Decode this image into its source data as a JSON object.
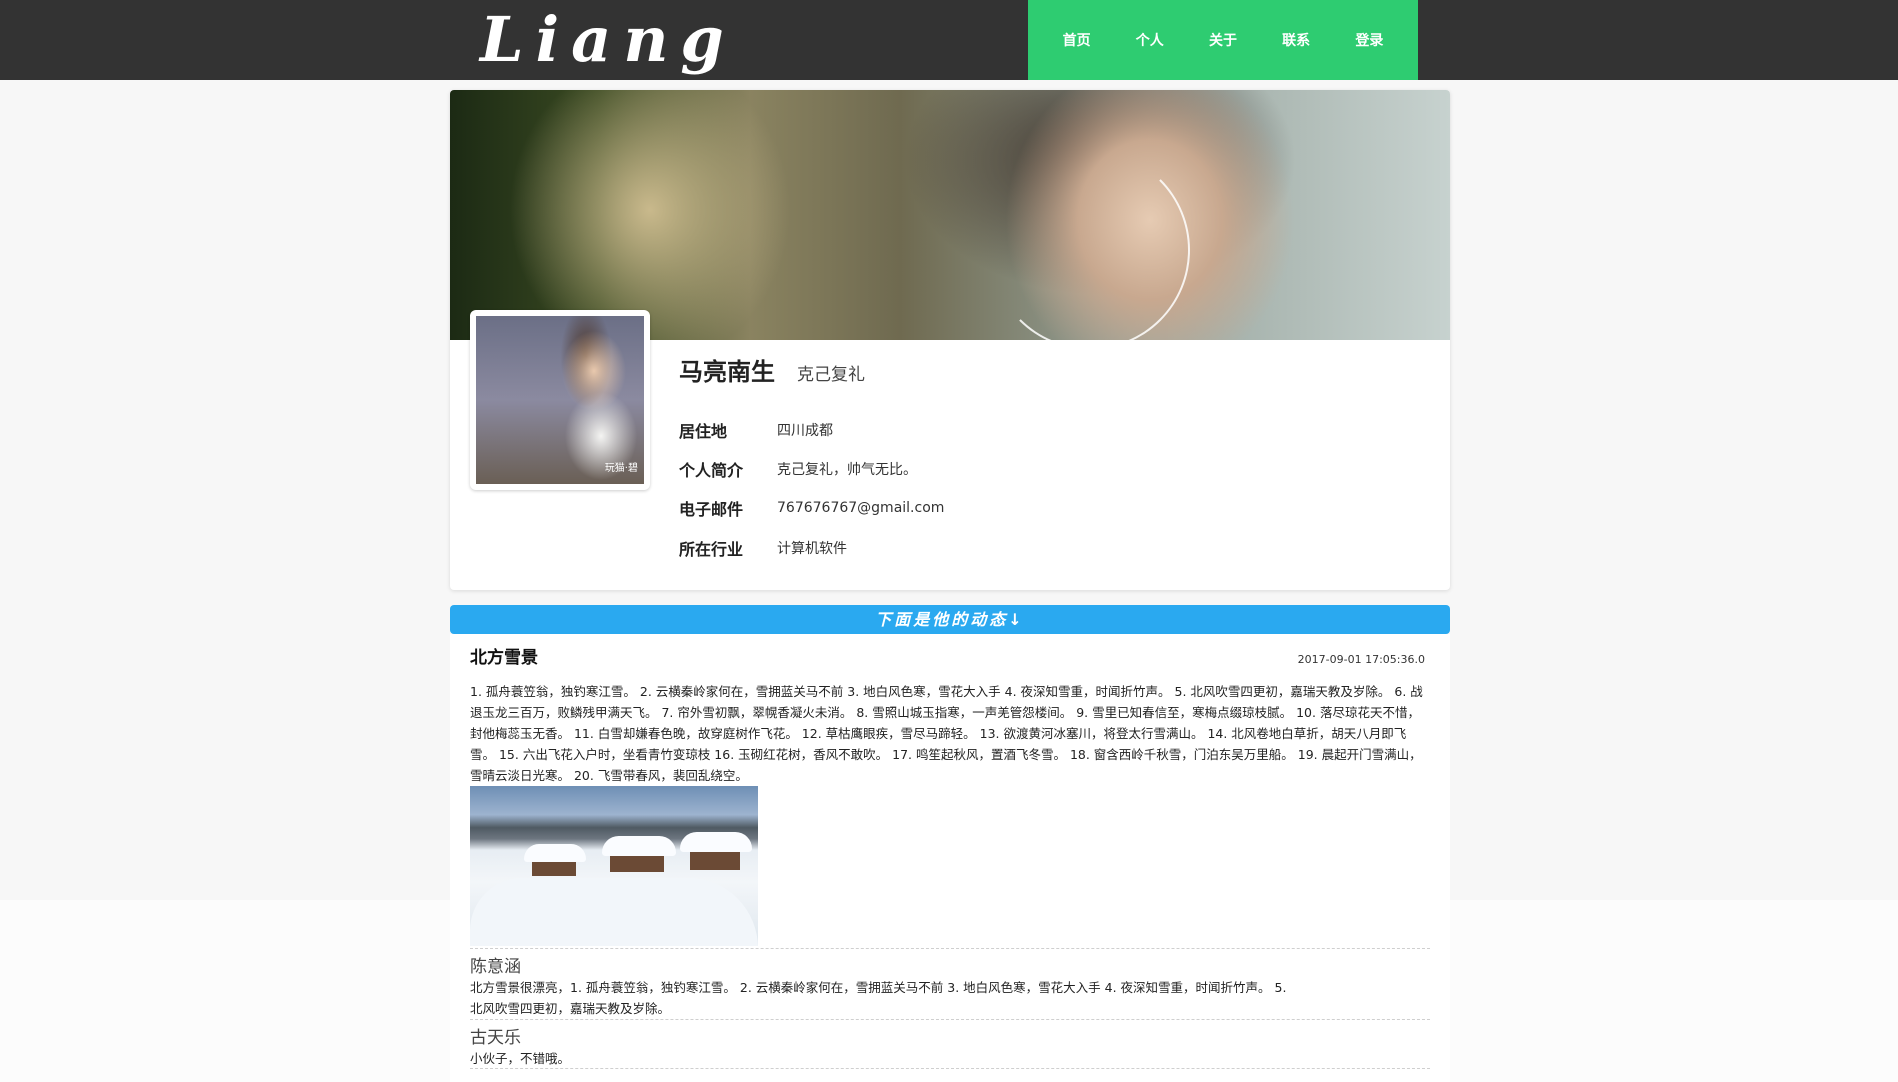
{
  "header": {
    "logo": "Liang",
    "nav": [
      "首页",
      "个人",
      "关于",
      "联系",
      "登录"
    ]
  },
  "profile": {
    "name": "马亮南生",
    "motto": "克己复礼",
    "avatar_caption": "玩猫·碧",
    "info": [
      {
        "label": "居住地",
        "value": "四川成都"
      },
      {
        "label": "个人简介",
        "value": "克己复礼，帅气无比。"
      },
      {
        "label": "电子邮件",
        "value": "767676767@gmail.com"
      },
      {
        "label": "所在行业",
        "value": "计算机软件"
      }
    ]
  },
  "feed": {
    "header": "下面是他的动态↓",
    "post": {
      "title": "北方雪景",
      "time": "2017-09-01 17:05:36.0",
      "body": "1. 孤舟蓑笠翁，独钓寒江雪。 2. 云横秦岭家何在，雪拥蓝关马不前 3. 地白风色寒，雪花大入手 4. 夜深知雪重，时闻折竹声。 5. 北风吹雪四更初，嘉瑞天教及岁除。 6. 战退玉龙三百万，败鳞残甲满天飞。 7. 帘外雪初飘，翠幌香凝火未消。 8. 雪照山城玉指寒，一声羌管怨楼间。 9. 雪里已知春信至，寒梅点缀琼枝腻。 10. 落尽琼花天不惜，封他梅蕊玉无香。 11. 白雪却嫌春色晚，故穿庭树作飞花。 12. 草枯鹰眼疾，雪尽马蹄轻。 13. 欲渡黄河冰塞川，将登太行雪满山。 14. 北风卷地白草折，胡天八月即飞雪。 15. 六出飞花入户时，坐看青竹变琼枝 16. 玉砌红花树，香风不敢吹。 17. 鸣笙起秋风，置酒飞冬雪。 18. 窗含西岭千秋雪，门泊东吴万里船。 19. 晨起开门雪满山，雪晴云淡日光寒。 20. 飞雪带春风，裴回乱绕空。",
      "comments": [
        {
          "author": "陈意涵",
          "text": "北方雪景很漂亮，1. 孤舟蓑笠翁，独钓寒江雪。 2. 云横秦岭家何在，雪拥蓝关马不前 3. 地白风色寒，雪花大入手 4. 夜深知雪重，时闻折竹声。 5. 北风吹雪四更初，嘉瑞天教及岁除。"
        },
        {
          "author": "古天乐",
          "text": "小伙子，不错哦。"
        }
      ]
    }
  },
  "colors": {
    "topbar": "#333333",
    "nav": "#2ecc71",
    "feed_header": "#2aa9f0"
  }
}
